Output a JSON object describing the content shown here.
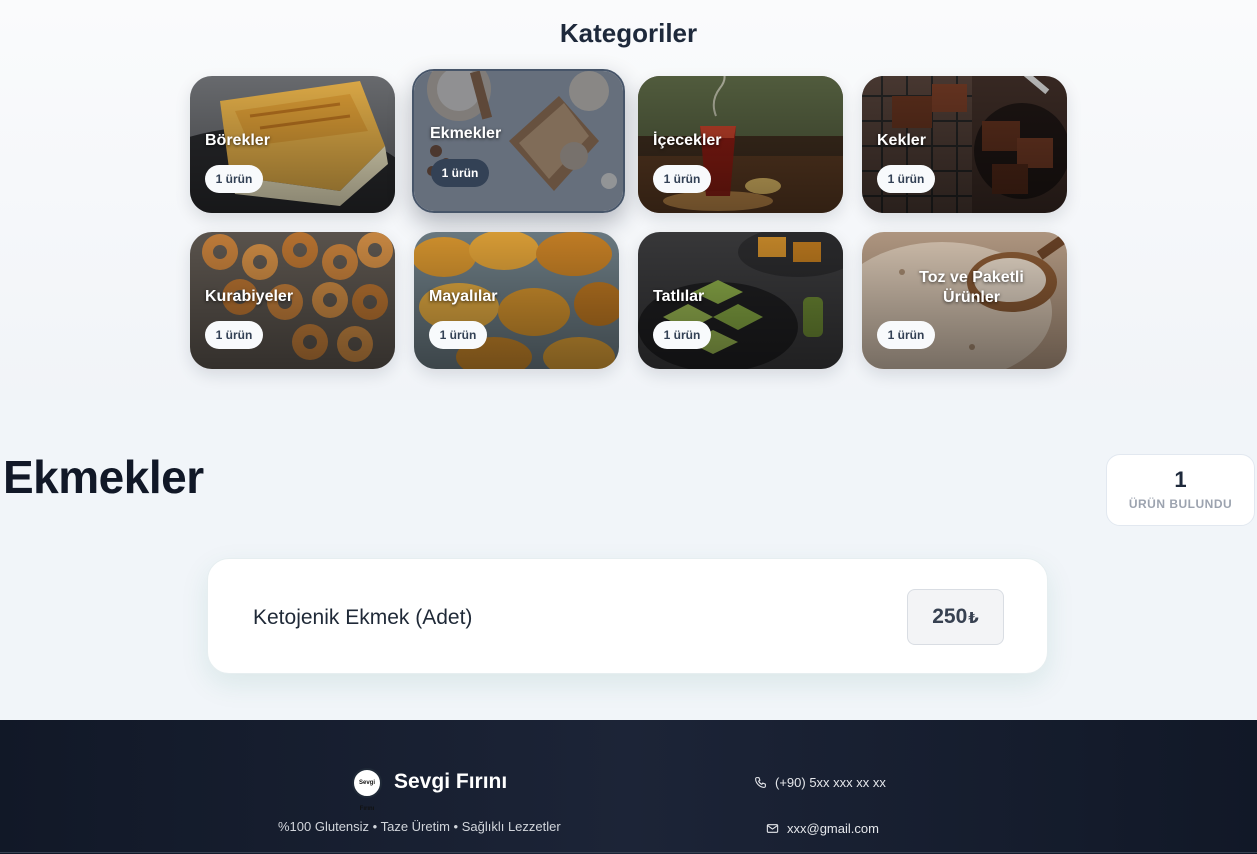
{
  "categories_section": {
    "title": "Kategoriler",
    "items": [
      {
        "name": "Börekler",
        "count_label": "1 ürün"
      },
      {
        "name": "Ekmekler",
        "count_label": "1 ürün"
      },
      {
        "name": "İçecekler",
        "count_label": "1 ürün"
      },
      {
        "name": "Kekler",
        "count_label": "1 ürün"
      },
      {
        "name": "Kurabiyeler",
        "count_label": "1 ürün"
      },
      {
        "name": "Mayalılar",
        "count_label": "1 ürün"
      },
      {
        "name": "Tatlılar",
        "count_label": "1 ürün"
      },
      {
        "name": "Toz ve Paketli Ürünler",
        "count_label": "1 ürün"
      }
    ],
    "active_category": "Ekmekler"
  },
  "main": {
    "title": "Ekmekler",
    "result_count": "1",
    "result_label": "ÜRÜN BULUNDU",
    "products": [
      {
        "name": "Ketojenik Ekmek (Adet)",
        "price": "250",
        "currency": "₺"
      }
    ]
  },
  "footer": {
    "brand_name": "Sevgi Fırını",
    "logo_text": "Sevgi Fırını",
    "tagline": "%100 Glutensiz • Taze Üretim • Sağlıklı Lezzetler",
    "phone": "(+90) 5xx xxx xx xx",
    "email": "xxx@gmail.com",
    "phone_icon": "phone-icon",
    "email_icon": "mail-icon"
  },
  "colors": {
    "page_background": "#f1f5f9",
    "footer_background": "#111827",
    "heading": "#111827",
    "badge_background": "#f8fafc",
    "active_badge_background": "#334155"
  }
}
